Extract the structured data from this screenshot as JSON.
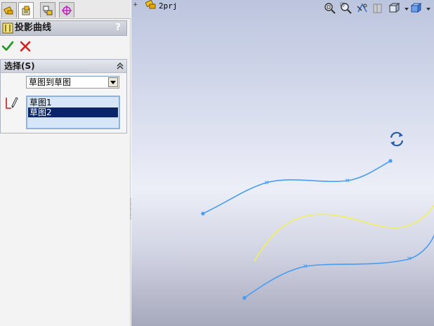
{
  "tabs": [
    {
      "icon": "feature-manager-icon"
    },
    {
      "icon": "property-manager-icon",
      "active": true
    },
    {
      "icon": "configuration-manager-icon"
    },
    {
      "icon": "dimxpert-manager-icon"
    }
  ],
  "property_manager": {
    "title": "投影曲线",
    "help": "?",
    "group": {
      "title": "选择(S)",
      "projection_type": "草图到草图",
      "selected_items": [
        "草图1",
        "草图2"
      ],
      "highlighted_index": 1
    }
  },
  "graphics": {
    "tree_label": "2prj",
    "tree_expander": "+"
  },
  "colors": {
    "blue_curve": "#4a9cf2",
    "yellow_curve": "#f2ef58",
    "selection": "#0a246a"
  }
}
